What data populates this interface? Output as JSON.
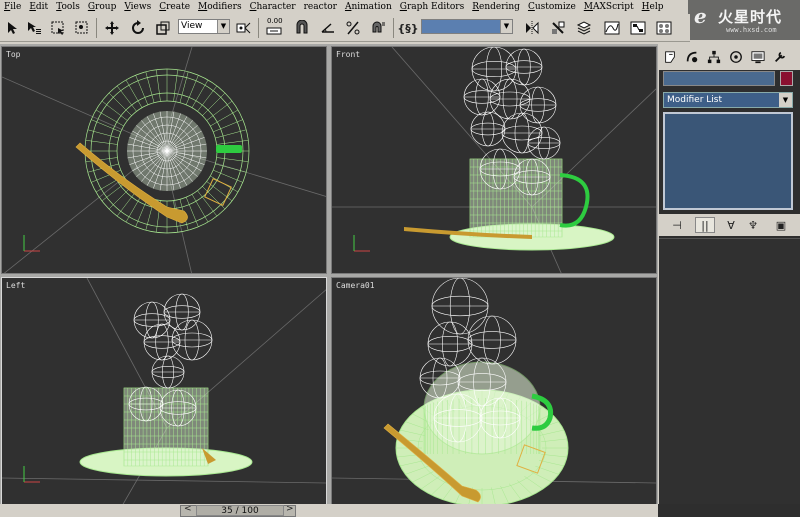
{
  "menu": [
    {
      "label": "File",
      "u": "F",
      "rest": "ile"
    },
    {
      "label": "Edit",
      "u": "E",
      "rest": "dit"
    },
    {
      "label": "Tools",
      "u": "T",
      "rest": "ools"
    },
    {
      "label": "Group",
      "u": "G",
      "rest": "roup"
    },
    {
      "label": "Views",
      "u": "V",
      "rest": "iews"
    },
    {
      "label": "Create",
      "u": "C",
      "rest": "reate"
    },
    {
      "label": "Modifiers",
      "u": "M",
      "rest": "odifiers"
    },
    {
      "label": "Character",
      "u": "C",
      "rest": "haracter"
    },
    {
      "label": "reactor",
      "u": "",
      "rest": "reactor"
    },
    {
      "label": "Animation",
      "u": "A",
      "rest": "nimation"
    },
    {
      "label": "Graph Editors",
      "u": "G",
      "rest": "raph Editors"
    },
    {
      "label": "Rendering",
      "u": "R",
      "rest": "endering"
    },
    {
      "label": "Customize",
      "u": "C",
      "rest": "ustomize"
    },
    {
      "label": "MAXScript",
      "u": "M",
      "rest": "AXScript"
    },
    {
      "label": "Help",
      "u": "H",
      "rest": "elp"
    }
  ],
  "brand": {
    "cjk": "火星时代",
    "url": "www.hxsd.com"
  },
  "toolbar": {
    "view_select": "View",
    "spinner_value": "0.00"
  },
  "viewports": {
    "top": "Top",
    "front": "Front",
    "left": "Left",
    "camera": "Camera01"
  },
  "command_panel": {
    "modifier_list": "Modifier List"
  },
  "timeslider": {
    "frame": "35 / 100",
    "prev": "<",
    "next": ">"
  },
  "colors": {
    "wire_green": "#a8e890",
    "wire_white": "#ffffff",
    "spoon": "#c89a30",
    "viewport_bg": "#303030"
  }
}
